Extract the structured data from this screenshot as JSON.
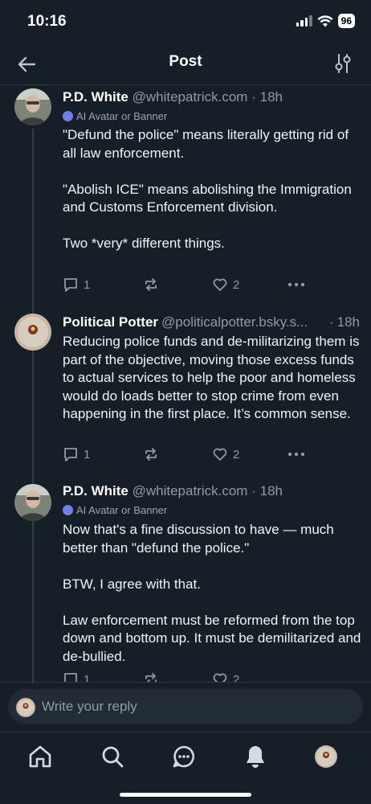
{
  "status_bar": {
    "time": "10:16",
    "battery": "96"
  },
  "header": {
    "title": "Post"
  },
  "posts": [
    {
      "name": "P.D. White",
      "handle": "@whitepatrick.com",
      "time": "18h",
      "label": "AI Avatar or Banner",
      "text": "\"Defund the police\" means literally getting rid of all law enforcement.\n\n\"Abolish ICE\" means abolishing the Immigration and Customs Enforcement division.\n\nTwo *very* different things.",
      "replies": "1",
      "likes": "2"
    },
    {
      "name": "Political Potter",
      "handle": "@politicalpotter.bsky.s...",
      "time": "18h",
      "text": "Reducing police funds and de-militarizing them is part of the objective, moving those excess funds to actual services to help the poor and homeless would do loads better to stop crime from even happening in the first place. It’s common sense.",
      "replies": "1",
      "likes": "2"
    },
    {
      "name": "P.D. White",
      "handle": "@whitepatrick.com",
      "time": "18h",
      "label": "AI Avatar or Banner",
      "text": "Now that's a fine discussion to have — much better than \"defund the police.\"\n\nBTW, I agree with that.\n\nLaw enforcement must be reformed from the top down and bottom up. It must be demilitarized and de-bullied.",
      "replies": "1",
      "likes": "2"
    }
  ],
  "reply_bar": {
    "placeholder": "Write your reply"
  },
  "separator": "·",
  "icons": {
    "back": "arrow-left-icon",
    "tune": "sliders-icon",
    "reply": "speech-bubble-icon",
    "repost": "repost-icon",
    "like": "heart-icon",
    "more": "ellipsis-icon",
    "tabs": [
      "home-icon",
      "search-icon",
      "chat-icon",
      "bell-icon",
      "profile-avatar"
    ]
  },
  "colors": {
    "background": "#161e27",
    "muted": "#8d9bab",
    "accent": "#6f7ee8"
  }
}
